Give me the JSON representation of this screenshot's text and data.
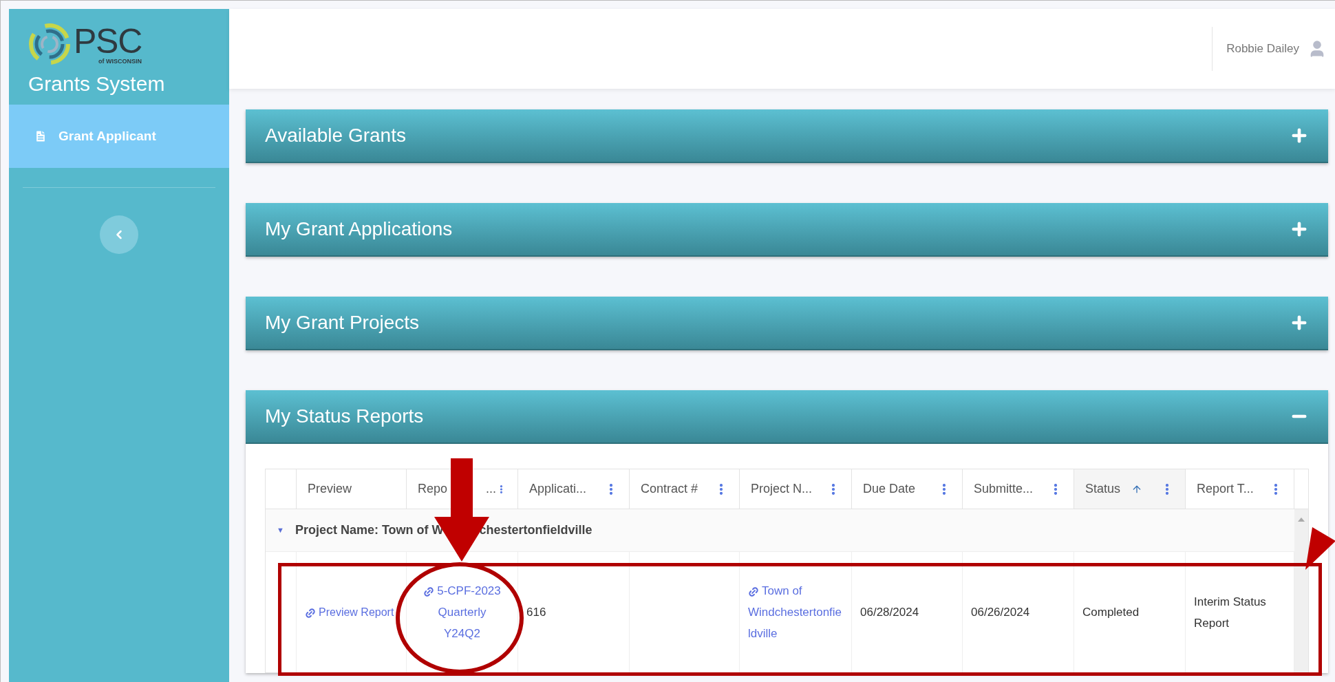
{
  "sidebar": {
    "logo": {
      "wordmark": "PSC",
      "tagline": "of WISCONSIN"
    },
    "title": "Grants System",
    "items": [
      {
        "label": "Grant Applicant",
        "selected": true
      }
    ]
  },
  "header": {
    "user": "Robbie Dailey"
  },
  "panels": [
    {
      "title": "Available Grants",
      "expanded": false
    },
    {
      "title": "My Grant Applications",
      "expanded": false
    },
    {
      "title": "My Grant Projects",
      "expanded": false
    },
    {
      "title": "My Status Reports",
      "expanded": true
    }
  ],
  "table": {
    "columns": [
      {
        "label": "Preview",
        "menu": false,
        "sorted": false
      },
      {
        "label": "Repo",
        "label_tail": "...",
        "menu": true,
        "sorted": false
      },
      {
        "label": "Applicati...",
        "menu": true,
        "sorted": false
      },
      {
        "label": "Contract #",
        "menu": true,
        "sorted": false
      },
      {
        "label": "Project N...",
        "menu": true,
        "sorted": false
      },
      {
        "label": "Due Date",
        "menu": true,
        "sorted": false
      },
      {
        "label": "Submitte...",
        "menu": true,
        "sorted": false
      },
      {
        "label": "Status",
        "menu": true,
        "sorted": true
      },
      {
        "label": "Report T...",
        "menu": true,
        "sorted": false
      }
    ],
    "group": {
      "toggle": "▼",
      "label": "Project Name: Town of W",
      "label_tail": "chestertonfieldville",
      "expanded": true
    },
    "rows": [
      {
        "cells": [
          {
            "kind": "link",
            "text": "Preview Report"
          },
          {
            "kind": "link",
            "text": "5-CPF-2023 Quarterly Y24Q2"
          },
          {
            "kind": "text",
            "text": "616"
          },
          {
            "kind": "empty"
          },
          {
            "kind": "link",
            "text": "Town of Windchestertonfieldville"
          },
          {
            "kind": "text",
            "text": "06/28/2024"
          },
          {
            "kind": "text",
            "text": "06/26/2024"
          },
          {
            "kind": "text",
            "text": "Completed"
          },
          {
            "kind": "text",
            "text": "Interim Status Report"
          }
        ]
      }
    ]
  }
}
